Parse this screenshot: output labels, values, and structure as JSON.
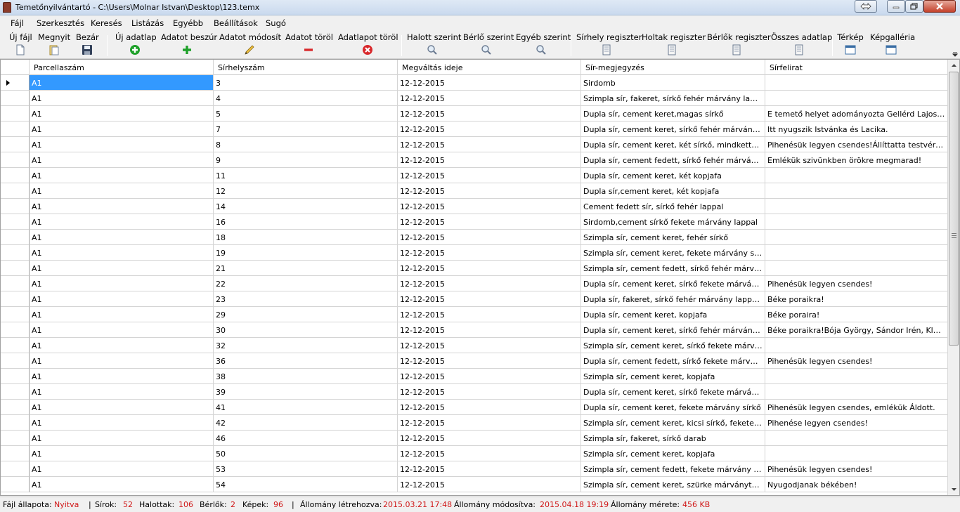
{
  "window": {
    "title": "Temetőnyilvántartó  -  C:\\Users\\Molnar Istvan\\Desktop\\123.temx"
  },
  "menu": [
    "Fájl",
    "Szerkesztés",
    "Keresés",
    "Listázás",
    "Egyébb",
    "Beállítások",
    "Sugó"
  ],
  "toolbar": {
    "new_file": "Új fájl",
    "open": "Megnyit",
    "close": "Bezár",
    "new_record": "Új adatlap",
    "insert_record": "Adatot beszúr",
    "edit_record": "Adatot módosít",
    "delete_record": "Adatot töröl",
    "delete_sheet": "Adatlapot töröl",
    "search_deceased": "Halott szerint",
    "search_tenant": "Bérlő szerint",
    "search_other": "Egyéb szerint",
    "reg_graves": "Sírhely regiszter",
    "reg_dead": "Holtak regiszter",
    "reg_tenants": "Bérlők regiszter",
    "all_data": "Összes adatlap",
    "map": "Térkép",
    "gallery": "Képgalléria"
  },
  "colors": {
    "selection": "#3399ff",
    "status_value": "#d01818",
    "green_icon": "#1fa12a",
    "red_icon": "#d8282b"
  },
  "table": {
    "columns": [
      "Parcellaszám",
      "Sírhelyszám",
      "Megváltás ideje",
      "Sír-megjegyzés",
      "Sírfelirat"
    ],
    "rows": [
      [
        "A1",
        "3",
        "12-12-2015",
        "Sirdomb",
        ""
      ],
      [
        "A1",
        "4",
        "12-12-2015",
        "Szimpla sír, fakeret, sírkő fehér márvány lappal",
        ""
      ],
      [
        "A1",
        "5",
        "12-12-2015",
        "Dupla sír, cement keret,magas sírkő",
        "E temető helyet adományozta Gellérd Lajos és neje ..."
      ],
      [
        "A1",
        "7",
        "12-12-2015",
        "Dupla sír, cement keret, sírkő fehér márvány lappal",
        "Itt nyugszik Istvánka és Lacika."
      ],
      [
        "A1",
        "8",
        "12-12-2015",
        "Dupla sír, cement keret, két sírkő, mindkettő fekete...",
        "Pihenésük legyen csendes!Állíttatta testvére Ferenc."
      ],
      [
        "A1",
        "9",
        "12-12-2015",
        "Dupla sír, cement fedett, sírkő fehér márványból,ké...",
        "Emlékük szivünkben örökre megmarad!"
      ],
      [
        "A1",
        "11",
        "12-12-2015",
        "Dupla sír, cement keret, két kopjafa",
        ""
      ],
      [
        "A1",
        "12",
        "12-12-2015",
        "Dupla sír,cement keret, két kopjafa",
        ""
      ],
      [
        "A1",
        "14",
        "12-12-2015",
        "Cement fedett sír, sírkő fehér lappal",
        ""
      ],
      [
        "A1",
        "16",
        "12-12-2015",
        "Sirdomb,cement sírkő fekete márvány lappal",
        ""
      ],
      [
        "A1",
        "18",
        "12-12-2015",
        "Szimpla sír, cement keret, fehér sírkő",
        ""
      ],
      [
        "A1",
        "19",
        "12-12-2015",
        "Szimpla sír, cement keret, fekete márvány sírkő",
        ""
      ],
      [
        "A1",
        "21",
        "12-12-2015",
        "Szimpla sír, cement fedett, sírkő fehér márvány lappal",
        ""
      ],
      [
        "A1",
        "22",
        "12-12-2015",
        "Dupla sír, cement keret, sírkő fekete márvány lappal",
        "Pihenésük legyen csendes!"
      ],
      [
        "A1",
        "23",
        "12-12-2015",
        "Dupla sír, fakeret, sírkő fehér márvány lappal, fényk...",
        "Béke poraikra!"
      ],
      [
        "A1",
        "29",
        "12-12-2015",
        "Dupla sír, cement keret, kopjafa",
        "Béke porаira!"
      ],
      [
        "A1",
        "30",
        "12-12-2015",
        "Dupla sír, cement keret, sírkő fehér márvány lappal",
        "Béke poraikra!Bója György, Sándor Irén, Klopfer Sá..."
      ],
      [
        "A1",
        "32",
        "12-12-2015",
        "Szimpla sír, cement keret, sírkő fekete márvány lap...",
        ""
      ],
      [
        "A1",
        "36",
        "12-12-2015",
        "Dupla sír, cement fedett, sírkő fekete márvány lappal",
        "Pihenésük legyen csendes!"
      ],
      [
        "A1",
        "38",
        "12-12-2015",
        "Szimpla sír, cement keret, kopjafa",
        ""
      ],
      [
        "A1",
        "39",
        "12-12-2015",
        "Dupla sír, cement keret, sírkő fekete márvány lappal",
        ""
      ],
      [
        "A1",
        "41",
        "12-12-2015",
        "Dupla sír, cement keret, fekete márvány sírkő",
        "Pihenésük legyen csendes, emlékük Áldott."
      ],
      [
        "A1",
        "42",
        "12-12-2015",
        "Szimpla sír, cement keret, kicsi sírkő, fekete márvá...",
        "Pihenése legyen csendes!"
      ],
      [
        "A1",
        "46",
        "12-12-2015",
        "Szimpla sír, fakeret, sírkő darab",
        ""
      ],
      [
        "A1",
        "50",
        "12-12-2015",
        "Szimpla sír, cement keret, kopjafa",
        ""
      ],
      [
        "A1",
        "53",
        "12-12-2015",
        "Szimpla sír, cement fedett, fekete márvány sírkő",
        "Pihenésük legyen csendes!"
      ],
      [
        "A1",
        "54",
        "12-12-2015",
        "Szimpla sír, cement keret, szürke márványtömb lecs...",
        "Nyugodjanak békében!"
      ]
    ]
  },
  "status": {
    "file_state_label": "Fájl állapota:",
    "file_state_value": "Nyitva",
    "graves_label": "Sírok:",
    "graves_value": "52",
    "dead_label": "Halottak:",
    "dead_value": "106",
    "tenants_label": "Bérlők:",
    "tenants_value": "2",
    "images_label": "Képek:",
    "images_value": "96",
    "created_label": "Állomány létrehozva:",
    "created_value": "2015.03.21 17:48",
    "modified_label": "Állomány módosítva:",
    "modified_value": "2015.04.18 19:19",
    "size_label": "Állomány mérete:",
    "size_value": "456 KB"
  }
}
